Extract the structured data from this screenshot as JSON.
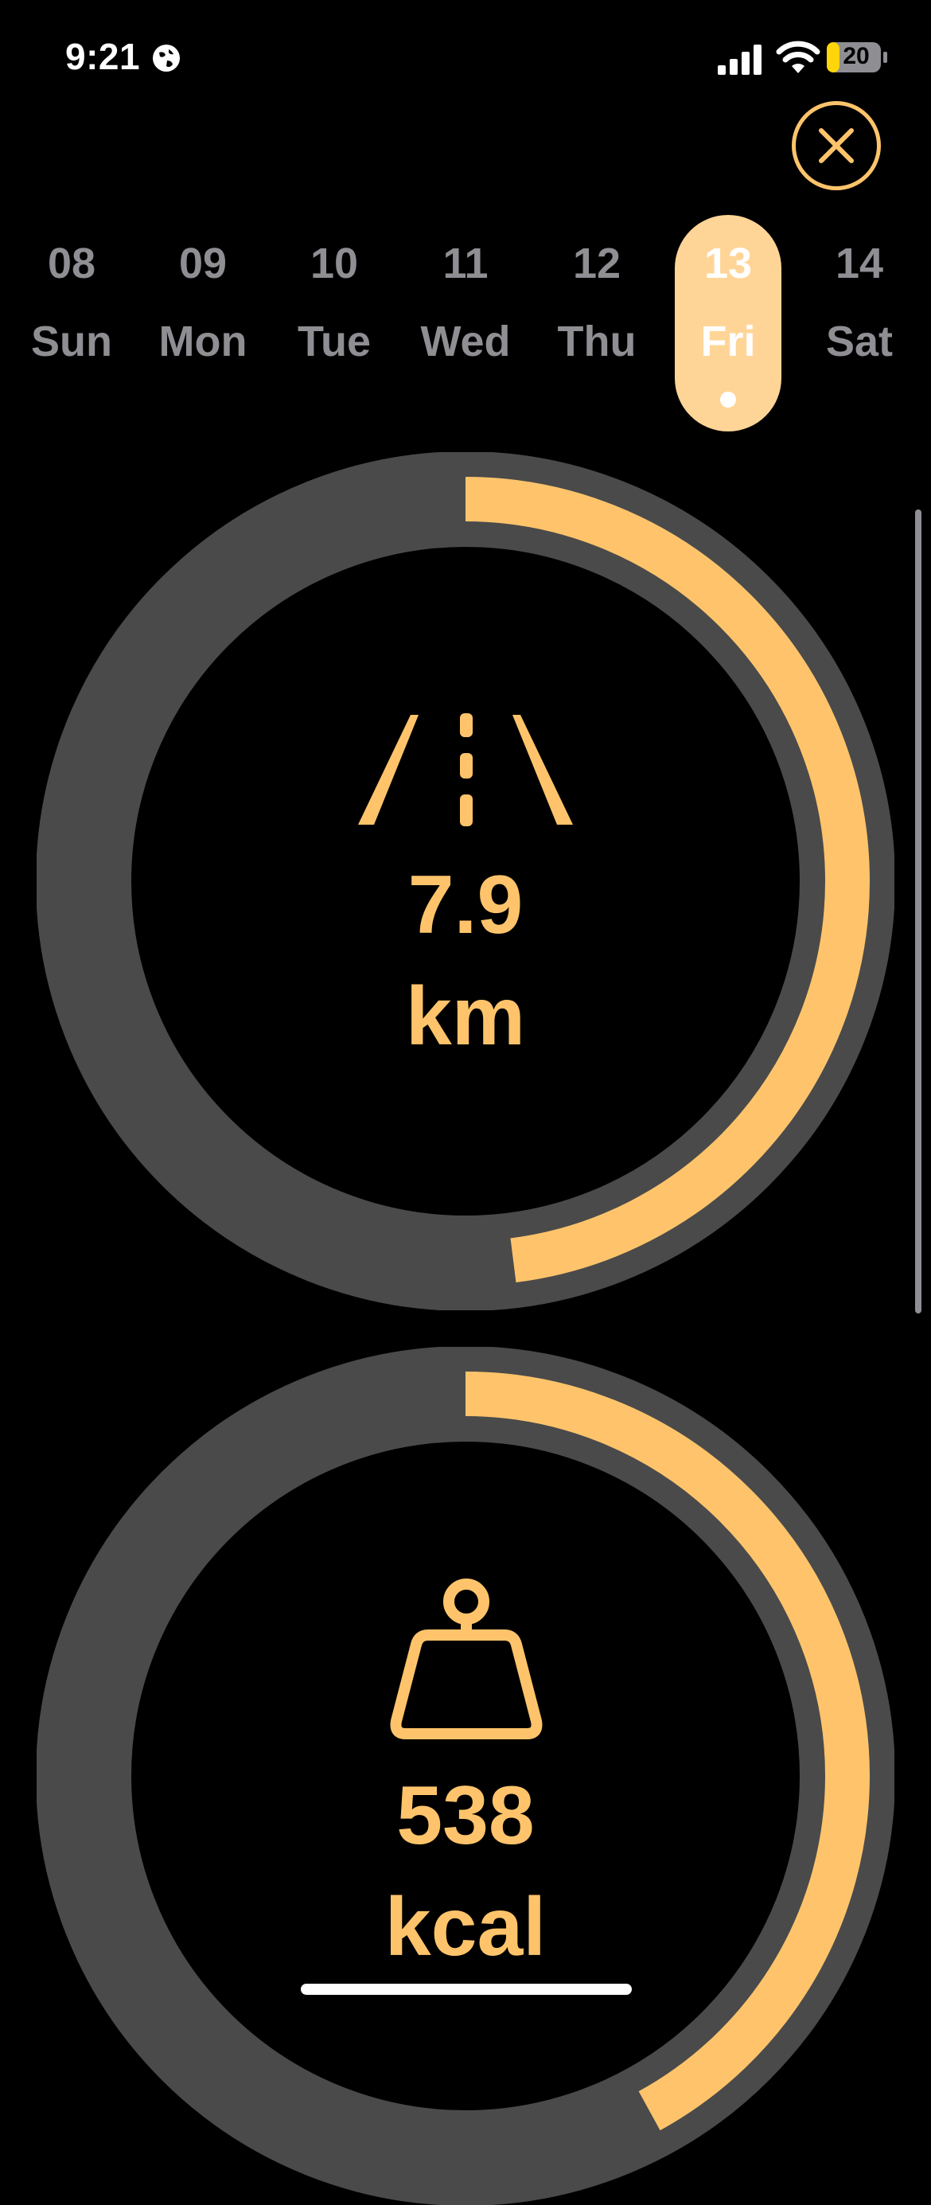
{
  "status_bar": {
    "time": "9:21",
    "battery": "20"
  },
  "close_button": {
    "icon": "close-icon"
  },
  "days": [
    {
      "num": "08",
      "name": "Sun",
      "selected": false
    },
    {
      "num": "09",
      "name": "Mon",
      "selected": false
    },
    {
      "num": "10",
      "name": "Tue",
      "selected": false
    },
    {
      "num": "11",
      "name": "Wed",
      "selected": false
    },
    {
      "num": "12",
      "name": "Thu",
      "selected": false
    },
    {
      "num": "13",
      "name": "Fri",
      "selected": true
    },
    {
      "num": "14",
      "name": "Sat",
      "selected": false
    }
  ],
  "rings": [
    {
      "icon": "road-icon",
      "value": "7.9",
      "unit": "km",
      "progress": 0.48
    },
    {
      "icon": "weight-icon",
      "value": "538",
      "unit": "kcal",
      "progress": 0.42
    }
  ],
  "colors": {
    "accent": "#ffc46b",
    "track": "#4a4a4a",
    "selected_day_bg": "#ffd597",
    "inactive_text": "#8e8e93",
    "background": "#000000"
  }
}
